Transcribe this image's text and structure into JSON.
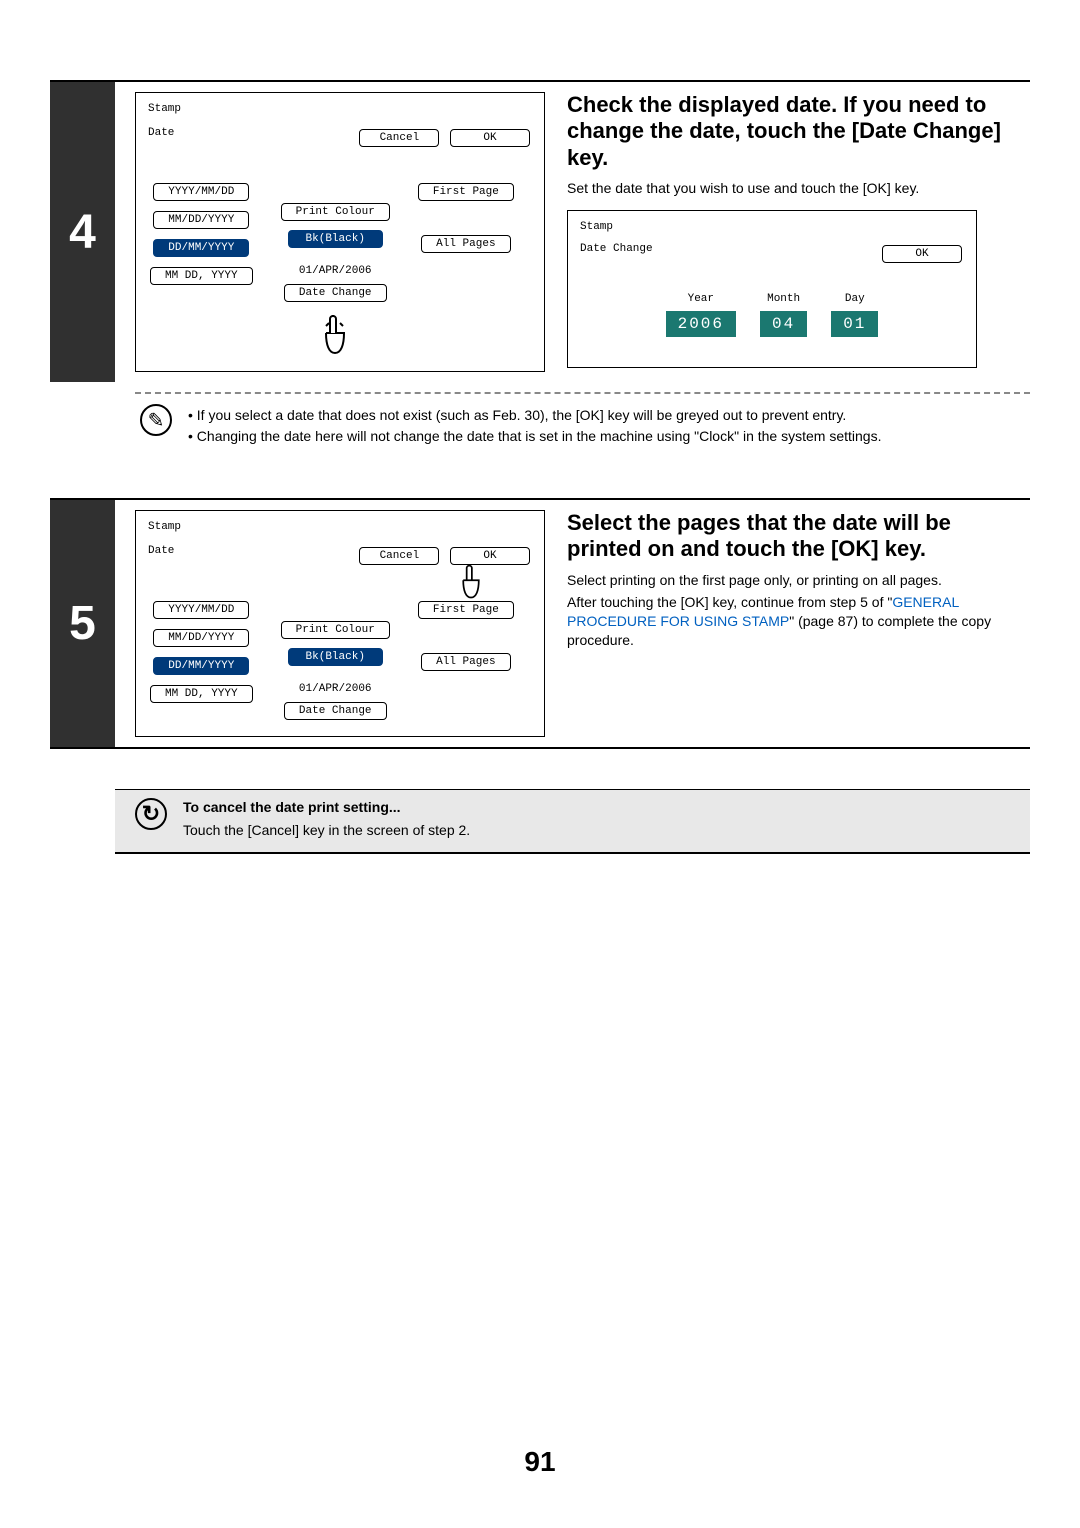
{
  "page_number": "91",
  "step4": {
    "number": "4",
    "title": "Check the displayed date. If you need to change the date, touch the [Date Change] key.",
    "subtext": "Set the date that you wish to use and touch the [OK] key.",
    "notes": [
      "• If you select a date that does not exist (such as Feb. 30), the [OK] key will be greyed out to prevent entry.",
      "• Changing the date here will not change the date that is set in the machine using \"Clock\" in the system settings."
    ],
    "panelA": {
      "stamp_label": "Stamp",
      "date_label": "Date",
      "cancel": "Cancel",
      "ok": "OK",
      "formats": [
        "YYYY/MM/DD",
        "MM/DD/YYYY",
        "DD/MM/YYYY",
        "MM DD, YYYY"
      ],
      "print_colour": "Print Colour",
      "bk_black": "Bk(Black)",
      "date_value": "01/APR/2006",
      "date_change": "Date Change",
      "first_page": "First Page",
      "all_pages": "All Pages"
    },
    "panelB": {
      "stamp_label": "Stamp",
      "date_change_label": "Date Change",
      "ok": "OK",
      "year_label": "Year",
      "month_label": "Month",
      "day_label": "Day",
      "year": "2006",
      "month": "04",
      "day": "01"
    }
  },
  "step5": {
    "number": "5",
    "title": "Select the pages that the date will be printed on and touch the [OK] key.",
    "body1": "Select printing on the first page only, or printing on all pages.",
    "body2_pre": "After touching the [OK] key, continue from step 5 of \"",
    "link_text": "GENERAL PROCEDURE FOR USING STAMP",
    "body2_post": "\" (page 87) to complete the copy procedure.",
    "panel": {
      "stamp_label": "Stamp",
      "date_label": "Date",
      "cancel": "Cancel",
      "ok": "OK",
      "formats": [
        "YYYY/MM/DD",
        "MM/DD/YYYY",
        "DD/MM/YYYY",
        "MM DD, YYYY"
      ],
      "print_colour": "Print Colour",
      "bk_black": "Bk(Black)",
      "date_value": "01/APR/2006",
      "date_change": "Date Change",
      "first_page": "First Page",
      "all_pages": "All Pages"
    }
  },
  "cancel_box": {
    "title": "To cancel the date print setting...",
    "body": "Touch the [Cancel] key in the screen of step 2."
  }
}
